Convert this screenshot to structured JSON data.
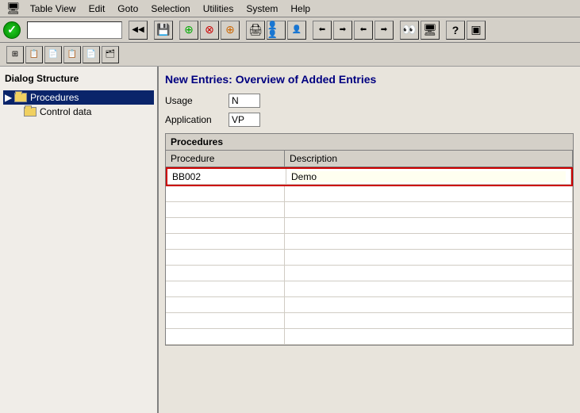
{
  "menubar": {
    "items": [
      {
        "id": "table-view",
        "label": "Table View"
      },
      {
        "id": "edit",
        "label": "Edit"
      },
      {
        "id": "goto",
        "label": "Goto"
      },
      {
        "id": "selection",
        "label": "Selection"
      },
      {
        "id": "utilities",
        "label": "Utilities"
      },
      {
        "id": "system",
        "label": "System"
      },
      {
        "id": "help",
        "label": "Help"
      }
    ]
  },
  "page_title": "New Entries: Overview of Added Entries",
  "dialog_structure": {
    "title": "Dialog Structure",
    "tree": [
      {
        "id": "procedures",
        "label": "Procedures",
        "level": 1,
        "selected": true
      },
      {
        "id": "control-data",
        "label": "Control data",
        "level": 2,
        "selected": false
      }
    ]
  },
  "fields": [
    {
      "id": "usage",
      "label": "Usage",
      "value": "N"
    },
    {
      "id": "application",
      "label": "Application",
      "value": "VP"
    }
  ],
  "procedures_table": {
    "title": "Procedures",
    "columns": [
      {
        "id": "procedure",
        "label": "Procedure"
      },
      {
        "id": "description",
        "label": "Description"
      }
    ],
    "rows": [
      {
        "procedure": "BB002",
        "description": "Demo",
        "active": true
      }
    ],
    "empty_rows": 10
  },
  "toolbar": {
    "cmd_placeholder": ""
  }
}
